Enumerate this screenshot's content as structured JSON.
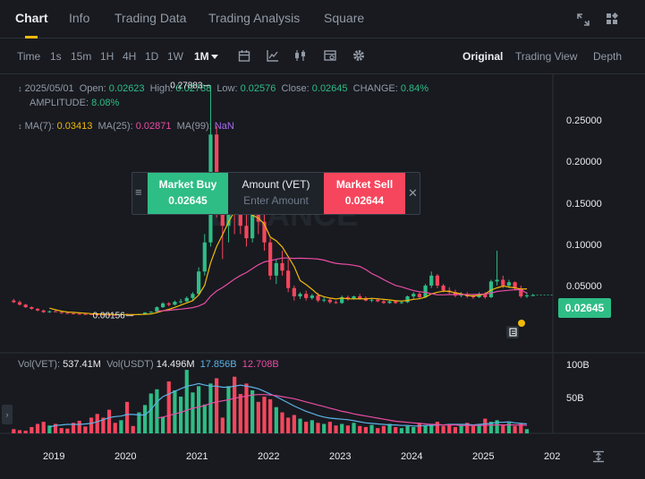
{
  "nav": {
    "tabs": [
      {
        "label": "Chart"
      },
      {
        "label": "Info"
      },
      {
        "label": "Trading Data"
      },
      {
        "label": "Trading Analysis"
      },
      {
        "label": "Square"
      }
    ]
  },
  "toolbar": {
    "intervals": [
      "Time",
      "1s",
      "15m",
      "1H",
      "4H",
      "1D",
      "1W",
      "1M"
    ],
    "selected_interval": "1M",
    "views": [
      "Original",
      "Trading View",
      "Depth"
    ],
    "selected_view": "Original"
  },
  "ohlc": {
    "date": "2025/05/01",
    "open_label": "Open:",
    "open": "0.02623",
    "high_label": "High:",
    "high": "0.02788",
    "low_label": "Low:",
    "low": "0.02576",
    "close_label": "Close:",
    "close": "0.02645",
    "change_label": "CHANGE:",
    "change": "0.84%",
    "amplitude_label": "AMPLITUDE:",
    "amplitude": "8.08%"
  },
  "ma": {
    "ma7_label": "MA(7):",
    "ma7": "0.03413",
    "ma25_label": "MA(25):",
    "ma25": "0.02871",
    "ma99_label": "MA(99):",
    "ma99": "NaN"
  },
  "volume": {
    "vol_label": "Vol(VET):",
    "vol": "537.41M",
    "usdt_label": "Vol(USDT)",
    "usdt": "14.496M",
    "ma1": "17.856B",
    "ma2": "12.708B"
  },
  "trade_panel": {
    "buy_label": "Market Buy",
    "buy_price": "0.02645",
    "amount_label": "Amount (VET)",
    "amount_placeholder": "Enter Amount",
    "sell_label": "Market Sell",
    "sell_price": "0.02644"
  },
  "current_price": "0.02645",
  "colors": {
    "up": "#2ebd85",
    "down": "#f6465d",
    "ma7": "#f0b90b",
    "ma25": "#e94ca3",
    "vol_ma1": "#5cb3e6",
    "vol_ma2": "#e94ca3"
  },
  "chart_data": {
    "type": "candlestick",
    "interval": "1M",
    "watermark": "BINANCE",
    "price_axis_ticks": [
      "0.25000",
      "0.20000",
      "0.15000",
      "0.10000",
      "0.05000"
    ],
    "volume_axis_ticks": [
      "100B",
      "50B"
    ],
    "x_tick_labels": [
      "2019",
      "2020",
      "2021",
      "2022",
      "2023",
      "2024",
      "2025",
      "202"
    ],
    "ylim": [
      -0.03,
      0.285
    ],
    "vol_ylim": [
      0,
      140
    ],
    "annotations": {
      "max": "0.27883",
      "min": "0.00156"
    },
    "start_month": "2018-08",
    "candles": [
      [
        0.02,
        0.022,
        0.017,
        0.018
      ],
      [
        0.018,
        0.02,
        0.014,
        0.015
      ],
      [
        0.015,
        0.016,
        0.011,
        0.012
      ],
      [
        0.012,
        0.013,
        0.009,
        0.01
      ],
      [
        0.01,
        0.011,
        0.007,
        0.008
      ],
      [
        0.008,
        0.009,
        0.005,
        0.006
      ],
      [
        0.006,
        0.008,
        0.005,
        0.007
      ],
      [
        0.007,
        0.009,
        0.006,
        0.006
      ],
      [
        0.006,
        0.007,
        0.004,
        0.005
      ],
      [
        0.005,
        0.006,
        0.004,
        0.0045
      ],
      [
        0.0045,
        0.005,
        0.0035,
        0.004
      ],
      [
        0.004,
        0.0045,
        0.003,
        0.0038
      ],
      [
        0.0038,
        0.0045,
        0.0032,
        0.0036
      ],
      [
        0.0036,
        0.004,
        0.003,
        0.0034
      ],
      [
        0.0034,
        0.004,
        0.0028,
        0.0032
      ],
      [
        0.0032,
        0.0038,
        0.0028,
        0.003
      ],
      [
        0.003,
        0.0036,
        0.0025,
        0.0028
      ],
      [
        0.0028,
        0.0034,
        0.0024,
        0.0026
      ],
      [
        0.0026,
        0.004,
        0.0024,
        0.0036
      ],
      [
        0.0036,
        0.0042,
        0.003,
        0.0032
      ],
      [
        0.0032,
        0.0034,
        0.0016,
        0.0025
      ],
      [
        0.0025,
        0.004,
        0.0024,
        0.0038
      ],
      [
        0.0038,
        0.006,
        0.0036,
        0.0055
      ],
      [
        0.0055,
        0.007,
        0.005,
        0.0065
      ],
      [
        0.0065,
        0.013,
        0.006,
        0.012
      ],
      [
        0.012,
        0.018,
        0.011,
        0.0165
      ],
      [
        0.0165,
        0.018,
        0.013,
        0.015
      ],
      [
        0.015,
        0.02,
        0.014,
        0.0185
      ],
      [
        0.0185,
        0.022,
        0.016,
        0.019
      ],
      [
        0.019,
        0.025,
        0.018,
        0.023
      ],
      [
        0.023,
        0.03,
        0.02,
        0.028
      ],
      [
        0.028,
        0.06,
        0.026,
        0.055
      ],
      [
        0.055,
        0.1,
        0.05,
        0.09
      ],
      [
        0.09,
        0.2788,
        0.085,
        0.22
      ],
      [
        0.22,
        0.23,
        0.12,
        0.16
      ],
      [
        0.16,
        0.17,
        0.07,
        0.11
      ],
      [
        0.11,
        0.15,
        0.09,
        0.14
      ],
      [
        0.14,
        0.16,
        0.1,
        0.13
      ],
      [
        0.13,
        0.15,
        0.1,
        0.11
      ],
      [
        0.11,
        0.125,
        0.085,
        0.095
      ],
      [
        0.095,
        0.13,
        0.09,
        0.125
      ],
      [
        0.125,
        0.15,
        0.1,
        0.115
      ],
      [
        0.115,
        0.125,
        0.08,
        0.09
      ],
      [
        0.09,
        0.095,
        0.045,
        0.05
      ],
      [
        0.05,
        0.07,
        0.04,
        0.065
      ],
      [
        0.065,
        0.08,
        0.05,
        0.056
      ],
      [
        0.056,
        0.07,
        0.03,
        0.035
      ],
      [
        0.035,
        0.038,
        0.02,
        0.025
      ],
      [
        0.025,
        0.03,
        0.022,
        0.028
      ],
      [
        0.028,
        0.032,
        0.02,
        0.023
      ],
      [
        0.023,
        0.028,
        0.021,
        0.026
      ],
      [
        0.026,
        0.029,
        0.018,
        0.02
      ],
      [
        0.02,
        0.024,
        0.018,
        0.021
      ],
      [
        0.021,
        0.023,
        0.016,
        0.018
      ],
      [
        0.018,
        0.02,
        0.016,
        0.017
      ],
      [
        0.017,
        0.026,
        0.016,
        0.024
      ],
      [
        0.024,
        0.026,
        0.02,
        0.022
      ],
      [
        0.022,
        0.026,
        0.021,
        0.025
      ],
      [
        0.025,
        0.028,
        0.021,
        0.023
      ],
      [
        0.023,
        0.025,
        0.019,
        0.02
      ],
      [
        0.02,
        0.023,
        0.018,
        0.021
      ],
      [
        0.021,
        0.023,
        0.018,
        0.019
      ],
      [
        0.019,
        0.021,
        0.016,
        0.017
      ],
      [
        0.017,
        0.02,
        0.016,
        0.019
      ],
      [
        0.019,
        0.02,
        0.016,
        0.017
      ],
      [
        0.017,
        0.02,
        0.016,
        0.018
      ],
      [
        0.018,
        0.026,
        0.017,
        0.025
      ],
      [
        0.025,
        0.03,
        0.022,
        0.028
      ],
      [
        0.028,
        0.03,
        0.022,
        0.024
      ],
      [
        0.024,
        0.04,
        0.023,
        0.038
      ],
      [
        0.038,
        0.055,
        0.035,
        0.05
      ],
      [
        0.05,
        0.052,
        0.035,
        0.038
      ],
      [
        0.038,
        0.04,
        0.03,
        0.032
      ],
      [
        0.032,
        0.036,
        0.028,
        0.03
      ],
      [
        0.03,
        0.033,
        0.024,
        0.026
      ],
      [
        0.026,
        0.03,
        0.024,
        0.027
      ],
      [
        0.027,
        0.03,
        0.023,
        0.025
      ],
      [
        0.025,
        0.027,
        0.022,
        0.024
      ],
      [
        0.024,
        0.03,
        0.023,
        0.028
      ],
      [
        0.028,
        0.03,
        0.022,
        0.024
      ],
      [
        0.024,
        0.045,
        0.023,
        0.043
      ],
      [
        0.043,
        0.08,
        0.038,
        0.045
      ],
      [
        0.045,
        0.05,
        0.035,
        0.038
      ],
      [
        0.038,
        0.045,
        0.035,
        0.042
      ],
      [
        0.042,
        0.043,
        0.032,
        0.035
      ],
      [
        0.035,
        0.038,
        0.023,
        0.025
      ],
      [
        0.025,
        0.03,
        0.023,
        0.0262
      ],
      [
        0.0262,
        0.0279,
        0.0258,
        0.0265
      ]
    ],
    "ma7": [
      null,
      null,
      null,
      null,
      null,
      null,
      0.0108,
      0.0088,
      0.0072,
      0.0061,
      0.0057,
      0.0052,
      0.0047,
      0.0042,
      0.0039,
      0.0036,
      0.0034,
      0.0031,
      0.0031,
      0.0031,
      0.003,
      0.0031,
      0.0034,
      0.0039,
      0.0054,
      0.0075,
      0.0094,
      0.0117,
      0.0144,
      0.0171,
      0.0198,
      0.0266,
      0.0384,
      0.0653,
      0.085,
      0.0993,
      0.1147,
      0.1276,
      0.1366,
      0.1286,
      0.1229,
      0.1193,
      0.1121,
      0.0964,
      0.0919,
      0.0846,
      0.0728,
      0.061,
      0.044,
      0.0391,
      0.0335,
      0.0271,
      0.0246,
      0.023,
      0.0219,
      0.023,
      0.022,
      0.022,
      0.0222,
      0.0219,
      0.0226,
      0.0221,
      0.0213,
      0.0207,
      0.0197,
      0.0194,
      0.0201,
      0.0215,
      0.0221,
      0.0242,
      0.028,
      0.03,
      0.0313,
      0.0311,
      0.0292,
      0.0281,
      0.0259,
      0.0256,
      0.0262,
      0.028,
      0.0326,
      0.0353,
      0.0374,
      0.0363,
      0.0352,
      0.0336,
      0.0341
    ],
    "ma25": [
      null,
      null,
      null,
      null,
      null,
      null,
      null,
      null,
      null,
      null,
      null,
      null,
      null,
      null,
      null,
      null,
      null,
      null,
      null,
      null,
      null,
      null,
      null,
      null,
      0.0073,
      0.0077,
      0.0082,
      0.0089,
      0.0096,
      0.0104,
      0.0114,
      0.0134,
      0.0167,
      0.0252,
      0.0315,
      0.0357,
      0.0407,
      0.0458,
      0.0501,
      0.0537,
      0.0585,
      0.063,
      0.0665,
      0.0679,
      0.0697,
      0.0712,
      0.0712,
      0.0708,
      0.071,
      0.0708,
      0.0705,
      0.0699,
      0.0687,
      0.0666,
      0.0648,
      0.064,
      0.0635,
      0.0625,
      0.061,
      0.0573,
      0.0525,
      0.0491,
      0.0452,
      0.0416,
      0.0382,
      0.0365,
      0.0341,
      0.0319,
      0.0306,
      0.0298,
      0.0283,
      0.0269,
      0.0269,
      0.0272,
      0.0272,
      0.0272,
      0.0274,
      0.0274,
      0.0276,
      0.0279,
      0.0289,
      0.0309,
      0.0317,
      0.0324,
      0.0331,
      0.033,
      0.0287
    ],
    "volume": [
      8,
      6,
      5,
      12,
      18,
      22,
      15,
      18,
      10,
      9,
      20,
      24,
      13,
      30,
      37,
      30,
      45,
      20,
      25,
      60,
      14,
      40,
      54,
      76,
      84,
      31,
      99,
      82,
      70,
      121,
      78,
      90,
      55,
      95,
      105,
      30,
      90,
      108,
      75,
      95,
      82,
      60,
      70,
      65,
      50,
      40,
      30,
      35,
      28,
      22,
      25,
      20,
      18,
      22,
      15,
      18,
      15,
      20,
      14,
      12,
      16,
      10,
      14,
      18,
      12,
      10,
      14,
      12,
      20,
      15,
      18,
      22,
      14,
      16,
      12,
      15,
      20,
      14,
      18,
      28,
      22,
      25,
      15,
      20,
      14,
      18,
      8
    ],
    "vol_ma1": [
      null,
      null,
      null,
      null,
      null,
      null,
      12,
      15,
      16,
      17,
      17,
      17,
      18,
      19,
      22,
      26,
      30,
      32,
      33,
      36,
      36,
      35,
      35,
      45,
      60,
      70,
      75,
      80,
      85,
      90,
      92,
      95,
      92,
      90,
      90,
      88,
      88,
      90,
      92,
      90,
      88,
      85,
      80,
      75,
      70,
      64,
      58,
      52,
      47,
      42,
      38,
      34,
      31,
      29,
      28,
      27,
      26,
      24,
      22,
      20,
      19,
      18,
      17,
      16,
      16,
      15,
      15,
      14,
      14,
      15,
      15,
      16,
      16,
      17,
      17,
      17,
      17,
      16,
      17,
      18,
      19,
      21,
      21,
      22,
      20,
      19,
      18
    ],
    "vol_ma2": [
      null,
      null,
      null,
      null,
      null,
      null,
      null,
      null,
      null,
      null,
      null,
      null,
      null,
      null,
      null,
      null,
      null,
      null,
      null,
      null,
      null,
      null,
      null,
      null,
      29,
      31,
      34,
      37,
      40,
      44,
      48,
      50,
      53,
      57,
      60,
      62,
      64,
      67,
      69,
      71,
      73,
      74,
      74,
      73,
      72,
      70,
      68,
      66,
      63,
      60,
      57,
      54,
      51,
      48,
      45,
      42,
      40,
      37,
      35,
      33,
      31,
      29,
      27,
      25,
      23,
      22,
      21,
      20,
      19,
      18,
      17,
      17,
      16,
      16,
      16,
      15,
      15,
      15,
      15,
      15,
      16,
      16,
      16,
      16,
      16,
      16,
      15
    ]
  }
}
